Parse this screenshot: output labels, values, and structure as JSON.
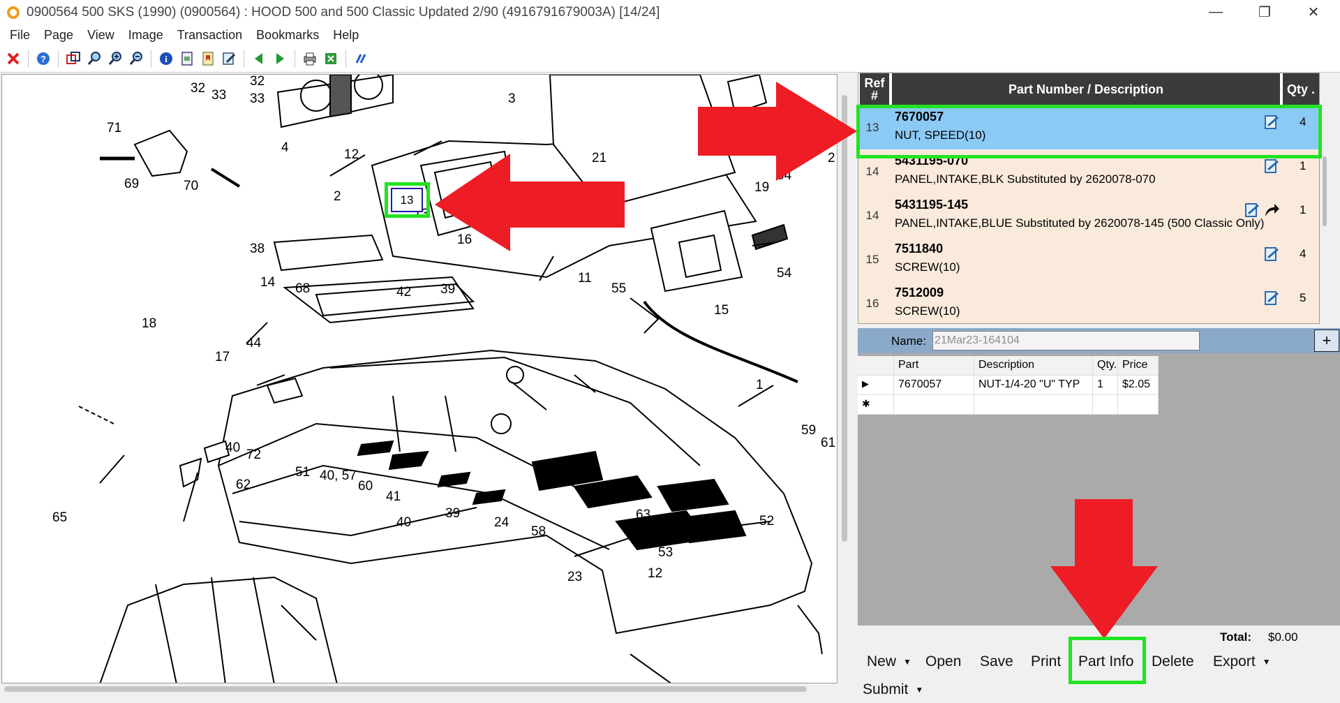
{
  "window": {
    "title": "0900564 500 SKS (1990) (0900564) : HOOD 500 and 500 Classic Updated 2/90 (4916791679003A) [14/24]",
    "minimize_glyph": "—",
    "restore_glyph": "❐",
    "close_glyph": "✕"
  },
  "menu": [
    "File",
    "Page",
    "View",
    "Image",
    "Transaction",
    "Bookmarks",
    "Help"
  ],
  "toolbar_icons": [
    "close-x-icon",
    "help-icon",
    "select-box-icon",
    "zoom-in-icon",
    "zoom-fit-icon",
    "zoom-out-icon",
    "info-icon",
    "page-setup-icon",
    "bookmark-icon",
    "edit-icon",
    "prev-page-icon",
    "next-page-icon",
    "print-icon",
    "export-icon",
    "link-icon"
  ],
  "diagram": {
    "labels": [
      {
        "t": "32"
      },
      {
        "t": "33"
      },
      {
        "t": "32"
      },
      {
        "t": "33"
      },
      {
        "t": "3"
      },
      {
        "t": "4"
      },
      {
        "t": "12"
      },
      {
        "t": "71"
      },
      {
        "t": "69"
      },
      {
        "t": "70"
      },
      {
        "t": "21"
      },
      {
        "t": "64"
      },
      {
        "t": "2"
      },
      {
        "t": "2"
      },
      {
        "t": "19"
      },
      {
        "t": "13"
      },
      {
        "t": "16"
      },
      {
        "t": "38"
      },
      {
        "t": "14"
      },
      {
        "t": "11"
      },
      {
        "t": "55"
      },
      {
        "t": "54"
      },
      {
        "t": "68"
      },
      {
        "t": "42"
      },
      {
        "t": "39"
      },
      {
        "t": "15"
      },
      {
        "t": "18"
      },
      {
        "t": "44"
      },
      {
        "t": "17"
      },
      {
        "t": "1"
      },
      {
        "t": "59"
      },
      {
        "t": "61"
      },
      {
        "t": "40"
      },
      {
        "t": "72"
      },
      {
        "t": "51"
      },
      {
        "t": "40, 57"
      },
      {
        "t": "60"
      },
      {
        "t": "41"
      },
      {
        "t": "39"
      },
      {
        "t": "63"
      },
      {
        "t": "62"
      },
      {
        "t": "65"
      },
      {
        "t": "40"
      },
      {
        "t": "24"
      },
      {
        "t": "58"
      },
      {
        "t": "52"
      },
      {
        "t": "53"
      },
      {
        "t": "12"
      },
      {
        "t": "23"
      }
    ],
    "selected_callout": "13"
  },
  "parts_table": {
    "headers": {
      "ref": "Ref #",
      "part": "Part Number / Description",
      "qty": "Qty ."
    },
    "rows": [
      {
        "ref": "13",
        "part": "7670057",
        "desc": "NUT, SPEED(10)",
        "qty": "4",
        "selected": true,
        "icons": [
          "note-icon"
        ]
      },
      {
        "ref": "14",
        "part": "5431195-070",
        "desc": "PANEL,INTAKE,BLK Substituted by 2620078-070",
        "qty": "1",
        "selected": false,
        "icons": [
          "note-icon"
        ]
      },
      {
        "ref": "14",
        "part": "5431195-145",
        "desc": "PANEL,INTAKE,BLUE Substituted by 2620078-145 (500 Classic Only)",
        "qty": "1",
        "selected": false,
        "icons": [
          "note-icon",
          "arrow-icon"
        ]
      },
      {
        "ref": "15",
        "part": "7511840",
        "desc": "SCREW(10)",
        "qty": "4",
        "selected": false,
        "icons": [
          "note-icon"
        ]
      },
      {
        "ref": "16",
        "part": "7512009",
        "desc": "SCREW(10)",
        "qty": "5",
        "selected": false,
        "icons": [
          "note-icon"
        ]
      }
    ]
  },
  "order": {
    "name_label": "Name:",
    "name_value": "21Mar23-164104",
    "add_label": "+",
    "columns": [
      "Part",
      "Description",
      "Qty.",
      "Price"
    ],
    "lines": [
      {
        "part": "7670057",
        "description": "NUT-1/4-20 \"U\" TYP",
        "qty": "1",
        "price": "$2.05"
      }
    ],
    "row_pointer": "▶",
    "new_row_marker": "✱",
    "total_label": "Total:",
    "total_value": "$0.00"
  },
  "actions": {
    "new": "New",
    "open": "Open",
    "save": "Save",
    "print": "Print",
    "part_info": "Part Info",
    "delete": "Delete",
    "export": "Export",
    "submit": "Submit"
  },
  "annotation_colors": {
    "highlight": "#22e322",
    "arrow": "#ee1c25",
    "selected_row": "#8ccaf6",
    "row_bg": "#faeadb"
  }
}
